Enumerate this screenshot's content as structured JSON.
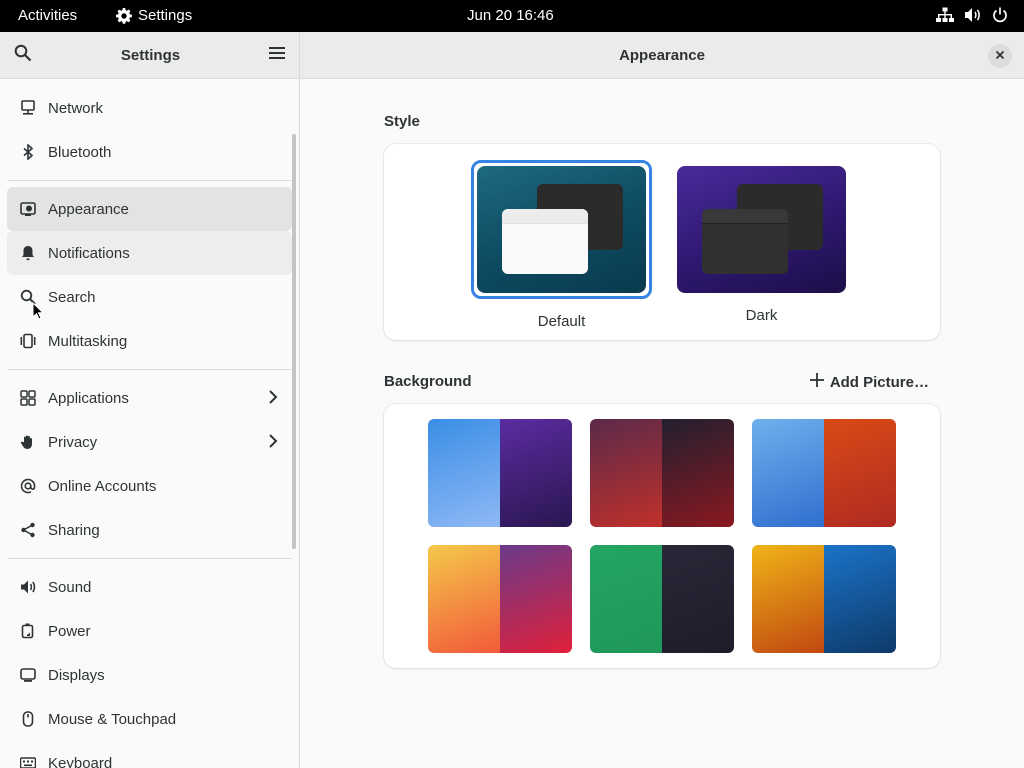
{
  "topbar": {
    "activities": "Activities",
    "app_name": "Settings",
    "clock": "Jun 20  16:46"
  },
  "sidebar": {
    "title": "Settings",
    "groups": [
      [
        {
          "label": "Network",
          "icon": "network-icon"
        },
        {
          "label": "Bluetooth",
          "icon": "bluetooth-icon"
        }
      ],
      [
        {
          "label": "Appearance",
          "icon": "appearance-icon",
          "selected": true
        },
        {
          "label": "Notifications",
          "icon": "bell-icon"
        },
        {
          "label": "Search",
          "icon": "search-icon"
        },
        {
          "label": "Multitasking",
          "icon": "multitasking-icon"
        }
      ],
      [
        {
          "label": "Applications",
          "icon": "applications-icon",
          "chevron": true
        },
        {
          "label": "Privacy",
          "icon": "hand-icon",
          "chevron": true
        },
        {
          "label": "Online Accounts",
          "icon": "at-icon"
        },
        {
          "label": "Sharing",
          "icon": "share-icon"
        }
      ],
      [
        {
          "label": "Sound",
          "icon": "speaker-icon"
        },
        {
          "label": "Power",
          "icon": "battery-icon"
        },
        {
          "label": "Displays",
          "icon": "display-icon"
        },
        {
          "label": "Mouse & Touchpad",
          "icon": "mouse-icon"
        },
        {
          "label": "Keyboard",
          "icon": "keyboard-icon"
        }
      ]
    ]
  },
  "main": {
    "title": "Appearance",
    "style_label": "Style",
    "style_options": [
      {
        "label": "Default",
        "selected": true
      },
      {
        "label": "Dark",
        "selected": false
      }
    ],
    "background_label": "Background",
    "add_picture": "Add Picture…",
    "backgrounds": [
      {
        "name": "blue-purple-hexagons",
        "left": [
          "#3a8ee6",
          "#8fb8f5"
        ],
        "right": [
          "#5b2ca0",
          "#2a1650"
        ]
      },
      {
        "name": "dark-red-hexagons",
        "left": [
          "#5a2a4a",
          "#c0302a"
        ],
        "right": [
          "#222030",
          "#8a1820"
        ]
      },
      {
        "name": "waves-blue-orange",
        "left": [
          "#6fb0ec",
          "#2f6fd0"
        ],
        "right": [
          "#d94a16",
          "#b02a22"
        ]
      },
      {
        "name": "gradient-orange-red",
        "left": [
          "#f4c84a",
          "#f25a3a"
        ],
        "right": [
          "#6a3a8a",
          "#e0203a"
        ]
      },
      {
        "name": "green-dots",
        "left": [
          "#23a563",
          "#1e9858"
        ],
        "right": [
          "#2a2838",
          "#1e1c2a"
        ]
      },
      {
        "name": "mosaic-gold-blue",
        "left": [
          "#f0b418",
          "#c04810"
        ],
        "right": [
          "#1b73c8",
          "#0e3a6a"
        ]
      }
    ]
  },
  "colors": {
    "accent": "#3584e4",
    "sidebar_bg": "#ebebeb",
    "content_bg": "#fafafa"
  }
}
